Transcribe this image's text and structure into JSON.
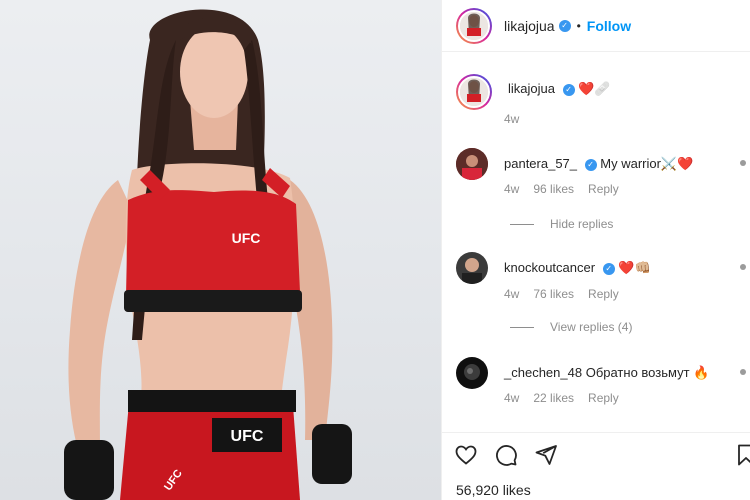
{
  "post": {
    "author": "likajojua",
    "follow_label": "Follow",
    "separator": "•",
    "caption_emojis": "❤️🩹",
    "caption_time": "4w",
    "likes": "56,920 likes"
  },
  "photo": {
    "bra_logo": "UFC",
    "shorts_logo": "UFC",
    "shorts_side_logo": "UFC",
    "accent_color": "#d31f26"
  },
  "comments": [
    {
      "user": "pantera_57_",
      "verified": true,
      "text": "My warrior⚔️❤️",
      "time": "4w",
      "likes": "96 likes",
      "reply": "Reply",
      "thread": "Hide replies"
    },
    {
      "user": "knockoutcancer",
      "verified": true,
      "text": "❤️👊🏼",
      "time": "4w",
      "likes": "76 likes",
      "reply": "Reply",
      "thread": "View replies (4)"
    },
    {
      "user": "_chechen_48",
      "verified": false,
      "text": "Обратно возьмут 🔥",
      "time": "4w",
      "likes": "22 likes",
      "reply": "Reply",
      "thread": ""
    }
  ],
  "icons": {
    "like": "heart-outline-icon",
    "comment": "comment-bubble-icon",
    "share": "paper-plane-icon",
    "save": "bookmark-icon",
    "verified": "verified-badge-icon"
  },
  "colors": {
    "link": "#0095f6",
    "muted": "#8e8e8e",
    "verified": "#3897f0",
    "heart": "#ed4956"
  }
}
